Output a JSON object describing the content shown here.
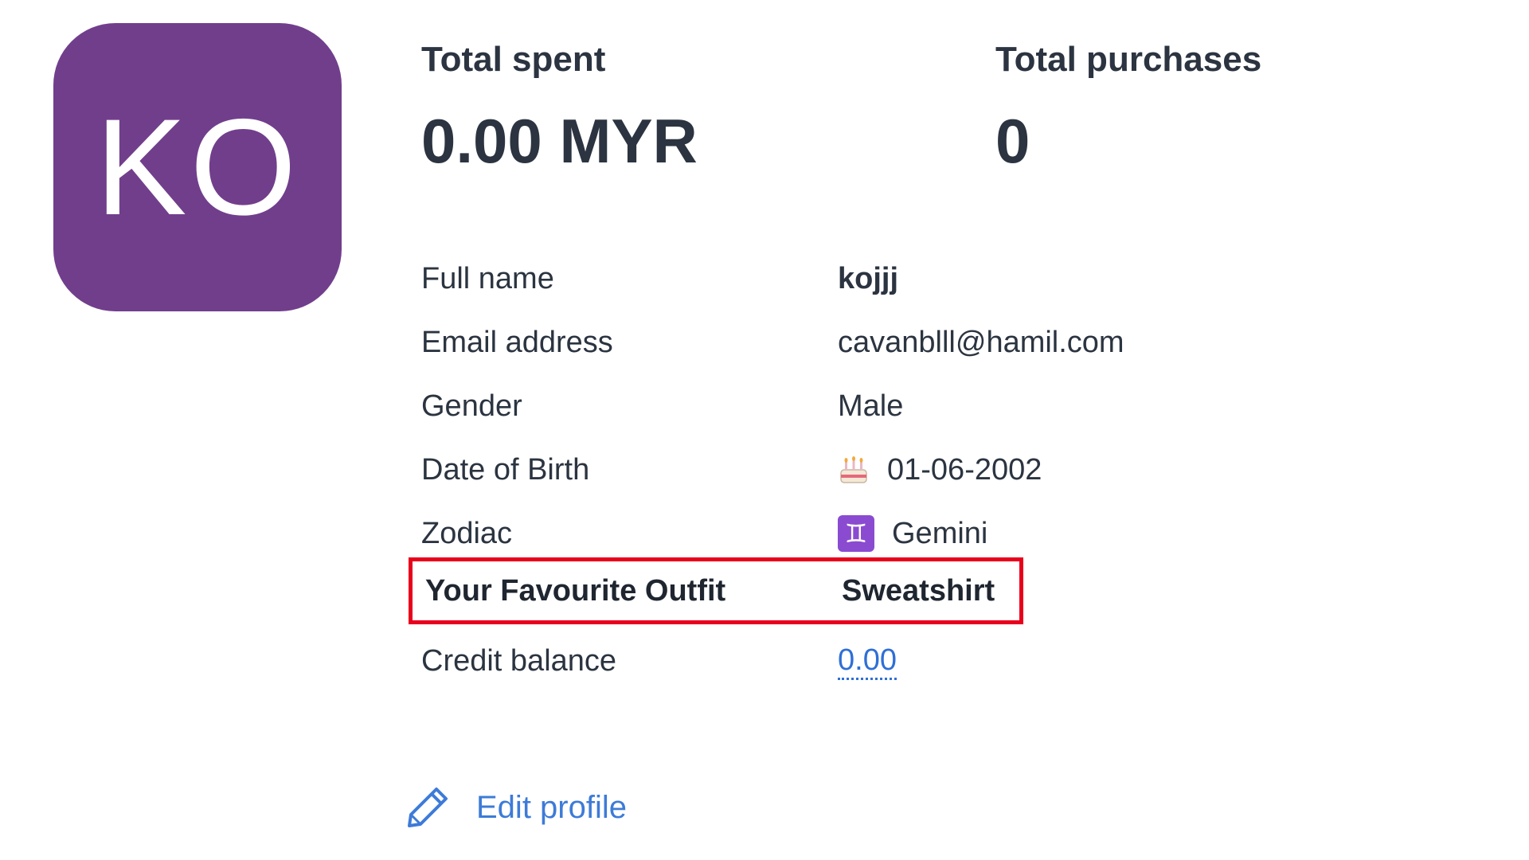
{
  "avatar": {
    "initials": "KO",
    "color": "#713e8c"
  },
  "stats": {
    "total_spent_label": "Total spent",
    "total_spent_value": "0.00 MYR",
    "total_purchases_label": "Total purchases",
    "total_purchases_value": "0"
  },
  "profile": {
    "full_name_label": "Full name",
    "full_name_value": "kojjj",
    "email_label": "Email address",
    "email_value": "cavanblll@hamil.com",
    "gender_label": "Gender",
    "gender_value": "Male",
    "dob_label": "Date of Birth",
    "dob_icon": "birthday-cake-icon",
    "dob_value": "01-06-2002",
    "zodiac_label": "Zodiac",
    "zodiac_icon": "gemini-icon",
    "zodiac_symbol": "♊",
    "zodiac_value": "Gemini",
    "outfit_label": "Your Favourite Outfit",
    "outfit_value": "Sweatshirt",
    "credit_label": "Credit balance",
    "credit_value": "0.00"
  },
  "actions": {
    "edit_profile_label": "Edit profile",
    "edit_profile_icon": "pencil-icon"
  },
  "colors": {
    "highlight_border": "#e8001c",
    "link": "#2f6fd6",
    "zodiac_badge": "#8a4bd1"
  }
}
